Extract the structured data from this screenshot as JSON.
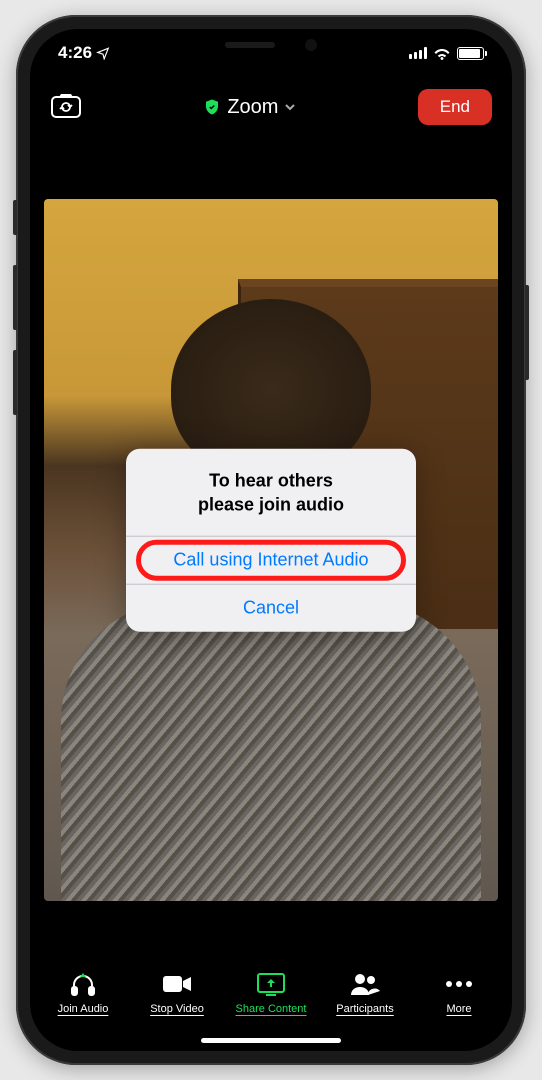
{
  "status_bar": {
    "time": "4:26",
    "location_arrow": "➤"
  },
  "header": {
    "title": "Zoom",
    "end_label": "End"
  },
  "dialog": {
    "title_line1": "To hear others",
    "title_line2": "please join audio",
    "primary_action": "Call using Internet Audio",
    "cancel_action": "Cancel"
  },
  "toolbar": {
    "items": [
      {
        "label": "Join Audio"
      },
      {
        "label": "Stop Video"
      },
      {
        "label": "Share Content"
      },
      {
        "label": "Participants"
      },
      {
        "label": "More"
      }
    ]
  }
}
